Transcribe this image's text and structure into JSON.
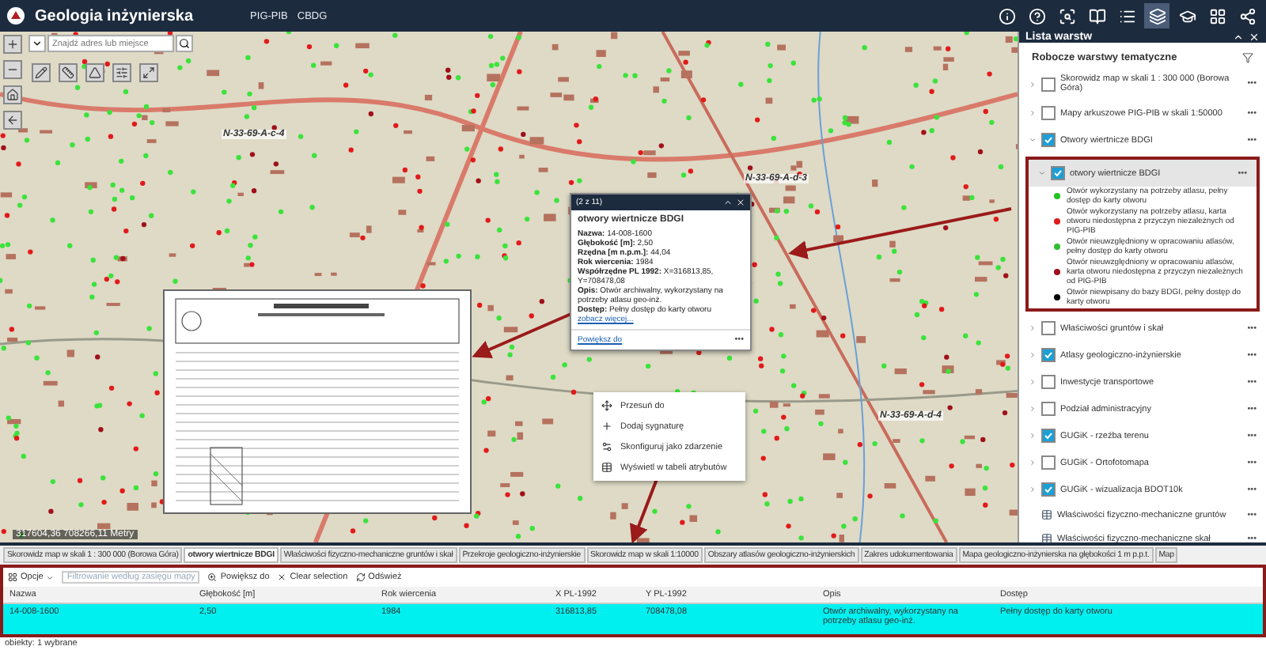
{
  "header": {
    "title": "Geologia inżynierska",
    "links": [
      "PIG-PIB",
      "CBDG"
    ],
    "tools": [
      {
        "kind": "info",
        "selected": false
      },
      {
        "kind": "help",
        "selected": false
      },
      {
        "kind": "search",
        "selected": false
      },
      {
        "kind": "book",
        "selected": false
      },
      {
        "kind": "list",
        "selected": false
      },
      {
        "kind": "layers",
        "selected": true
      },
      {
        "kind": "hat",
        "selected": false
      },
      {
        "kind": "grid",
        "selected": false
      },
      {
        "kind": "share",
        "selected": false
      }
    ]
  },
  "search": {
    "placeholder": "Znajdź adres lub miejsce"
  },
  "map": {
    "labels": [
      "N-33-69-A-c-4",
      "N-33-69-A-d-3",
      "N-33-69-A-d-4"
    ],
    "coordinates": "317604,36 708266,11 Metry"
  },
  "popup": {
    "counter": "(2 z 11)",
    "title": "otwory wiertnicze BDGI",
    "fields": [
      {
        "label": "Nazwa:",
        "value": "14-008-1600"
      },
      {
        "label": "Głębokość [m]:",
        "value": "2,50"
      },
      {
        "label": "Rzędna [m n.p.m.]:",
        "value": "44,04"
      },
      {
        "label": "Rok wiercenia:",
        "value": "1984"
      },
      {
        "label": "Współrzędne PL 1992:",
        "value": "X=316813,85, Y=708478,08"
      },
      {
        "label": "Opis:",
        "value": "Otwór archiwalny, wykorzystany na potrzeby atlasu geo-inż."
      },
      {
        "label": "Dostęp:",
        "value": "Pełny dostęp do karty otworu"
      }
    ],
    "more_link": "zobacz więcej...",
    "zoom_link": "Powiększ do",
    "menu_button": "•••"
  },
  "context_menu": [
    {
      "kind": "move",
      "label": "Przesuń do"
    },
    {
      "kind": "add",
      "label": "Dodaj sygnaturę"
    },
    {
      "kind": "config",
      "label": "Skonfiguruj jako zdarzenie"
    },
    {
      "kind": "table",
      "label": "Wyświetl w tabeli atrybutów"
    }
  ],
  "layer_panel": {
    "title": "Lista warstw",
    "subtitle": "Robocze warstwy tematyczne",
    "more": "•••",
    "layers": [
      {
        "kind": "check",
        "name": "Skorowidz map w skali 1 : 300 000 (Borowa Góra)",
        "checked": false,
        "expanded": false
      },
      {
        "kind": "check",
        "name": "Mapy arkuszowe PIG-PIB w skali 1:50000",
        "checked": false,
        "expanded": false
      },
      {
        "kind": "check",
        "name": "Otwory wiertnicze BDGI",
        "checked": true,
        "expanded": true,
        "children": [
          {
            "kind": "check",
            "name": "otwory wiertnicze BDGI",
            "checked": true,
            "expanded": true,
            "legend": [
              {
                "color": "#22c322",
                "label": "Otwór wykorzystany na potrzeby atlasu, pełny dostęp do karty otworu"
              },
              {
                "color": "#e01b1b",
                "label": "Otwór wykorzystany na potrzeby atlasu, karta otworu niedostępna z przyczyn niezależnych od PIG-PIB"
              },
              {
                "color": "#2fbf2f",
                "label": "Otwór nieuwzględniony w opracowaniu atlasów, pełny dostęp do karty otworu"
              },
              {
                "color": "#a0101a",
                "label": "Otwór nieuwzględniony w opracowaniu atlasów, karta otworu niedostępna z przyczyn niezależnych od PIG-PIB"
              },
              {
                "color": "#000000",
                "label": "Otwór niewpisany do bazy BDGI, pełny dostęp do karty otworu"
              }
            ]
          }
        ]
      },
      {
        "kind": "check",
        "name": "Właściwości gruntów i skał",
        "checked": false,
        "expanded": false
      },
      {
        "kind": "check",
        "name": "Atlasy geologiczno-inżynierskie",
        "checked": true,
        "expanded": false
      },
      {
        "kind": "check",
        "name": "Inwestycje transportowe",
        "checked": false,
        "expanded": false
      },
      {
        "kind": "check",
        "name": "Podział administracyjny",
        "checked": false,
        "expanded": false
      },
      {
        "kind": "check",
        "name": "GUGiK - rzeźba terenu",
        "checked": true,
        "expanded": false
      },
      {
        "kind": "check",
        "name": "GUGiK - Ortofotomapa",
        "checked": false,
        "expanded": false
      },
      {
        "kind": "check",
        "name": "GUGiK - wizualizacja BDOT10k",
        "checked": true,
        "expanded": false
      },
      {
        "kind": "table",
        "name": "Właściwości fizyczno-mechaniczne gruntów"
      },
      {
        "kind": "table",
        "name": "Właściwości fizyczno-mechaniczne skał"
      }
    ]
  },
  "bottom_tabs": [
    {
      "label": "Skorowidz map w skali 1 : 300 000 (Borowa Góra)",
      "selected": false
    },
    {
      "label": "otwory wiertnicze BDGI",
      "selected": true
    },
    {
      "label": "Właściwości fizyczno-mechaniczne gruntów i skał",
      "selected": false
    },
    {
      "label": "Przekroje geologiczno-inżynierskie",
      "selected": false
    },
    {
      "label": "Skorowidz map w skali 1:10000",
      "selected": false
    },
    {
      "label": "Obszary atlasów geologiczno-inżynierskich",
      "selected": false
    },
    {
      "label": "Zakres udokumentowania",
      "selected": false
    },
    {
      "label": "Mapa geologiczno-inżynierska na głębokości 1 m p.p.t.",
      "selected": false
    },
    {
      "label": "Map",
      "selected": false
    }
  ],
  "table_toolbar": {
    "options": "Opcje",
    "filter": "Filtrowanie według zasięgu mapy",
    "zoom": "Powiększ do",
    "clear": "Clear selection",
    "refresh": "Odśwież"
  },
  "table": {
    "columns": [
      "Nazwa",
      "Głębokość [m]",
      "Rok wiercenia",
      "X PL-1992",
      "Y PL-1992",
      "Opis",
      "Dostęp"
    ],
    "rows": [
      {
        "selected": true,
        "cells": [
          "14-008-1600",
          "2,50",
          "1984",
          "316813,85",
          "708478,08",
          "Otwór archiwalny, wykorzystany na potrzeby atlasu geo-inż.",
          "Pełny dostęp do karty otworu"
        ]
      }
    ]
  },
  "status_bar": "obiekty: 1 wybrane"
}
